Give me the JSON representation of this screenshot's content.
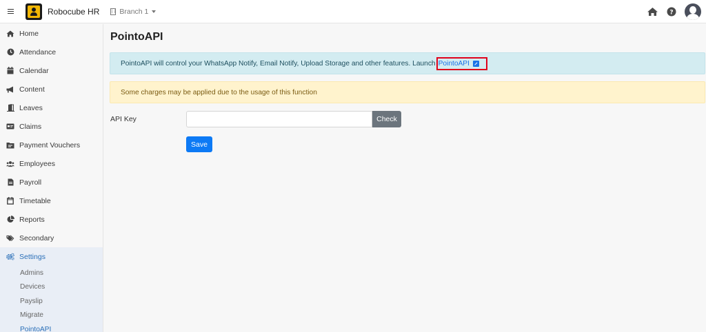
{
  "topbar": {
    "app_name": "Robocube HR",
    "branch_label": "Branch 1",
    "icons": [
      "menu-icon",
      "home-icon",
      "help-icon",
      "avatar"
    ]
  },
  "sidebar": {
    "items": [
      {
        "label": "Home",
        "icon": "home-icon"
      },
      {
        "label": "Attendance",
        "icon": "clock-icon"
      },
      {
        "label": "Calendar",
        "icon": "calendar-icon"
      },
      {
        "label": "Content",
        "icon": "megaphone-icon"
      },
      {
        "label": "Leaves",
        "icon": "door-icon"
      },
      {
        "label": "Claims",
        "icon": "card-icon"
      },
      {
        "label": "Payment Vouchers",
        "icon": "voucher-icon"
      },
      {
        "label": "Employees",
        "icon": "users-icon"
      },
      {
        "label": "Payroll",
        "icon": "document-icon"
      },
      {
        "label": "Timetable",
        "icon": "calendar-outline-icon"
      },
      {
        "label": "Reports",
        "icon": "pie-chart-icon"
      },
      {
        "label": "Secondary",
        "icon": "tags-icon"
      },
      {
        "label": "Settings",
        "icon": "cogs-icon"
      }
    ],
    "settings_sub": [
      "Admins",
      "Devices",
      "Payslip",
      "Migrate",
      "PointoAPI"
    ]
  },
  "main": {
    "title": "PointoAPI",
    "info_text": "PointoAPI will control your WhatsApp Notify, Email Notify, Upload Storage and other features. Launch",
    "info_link": "PointoAPI",
    "warning_text": "Some charges may be applied due to the usage of this function",
    "api_key_label": "API Key",
    "api_key_value": "",
    "check_label": "Check",
    "save_label": "Save"
  },
  "colors": {
    "accent": "#0d7af5",
    "info_bg": "#d3ecf1",
    "warning_bg": "#fff3cd",
    "highlight": "#e0001a",
    "logo": "#f2b705"
  }
}
